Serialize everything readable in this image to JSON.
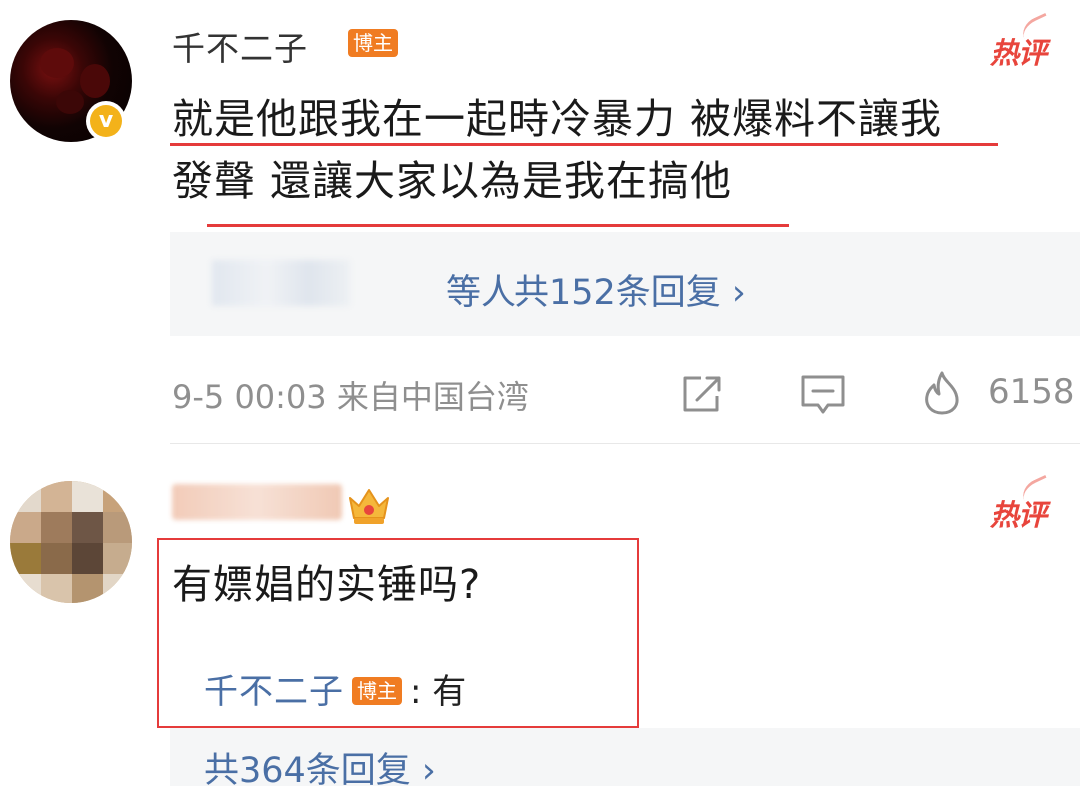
{
  "comment1": {
    "username": "千不二子",
    "badge": "博主",
    "hot_label": "热评",
    "verified_mark": "v",
    "text_line1": "就是他跟我在一起時冷暴力 被爆料不讓我",
    "text_line2": "發聲 還讓大家以為是我在搞他",
    "replies_names_suffix": "等人",
    "replies_count": "共152条回复 ›",
    "meta": "9-5 00:03 来自中国台湾",
    "likes": "6158"
  },
  "comment2": {
    "hot_label": "热评",
    "text": "有嫖娼的实锤吗?",
    "sub_reply": {
      "name": "千不二子",
      "badge": "博主",
      "separator": ":",
      "text": "有"
    },
    "replies_count": "共364条回复 ›"
  },
  "colors": {
    "link": "#4a6fa5",
    "badge": "#f07c22",
    "highlight": "#e53b3b",
    "verified": "#f3b21a"
  },
  "icons": [
    "share-icon",
    "comment-icon",
    "fire-like-icon",
    "crown-icon",
    "verified-icon"
  ]
}
